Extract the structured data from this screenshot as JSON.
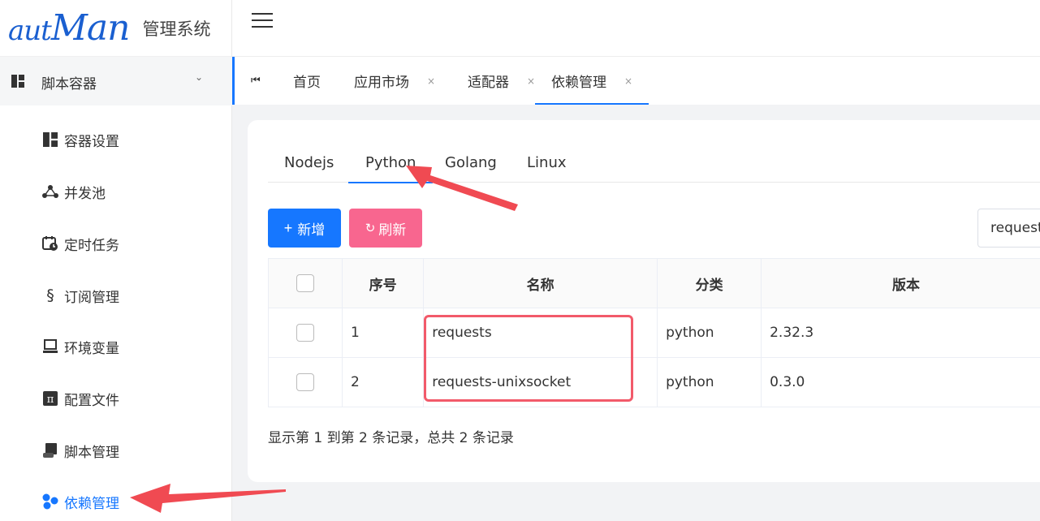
{
  "app": {
    "logo_text_small": "aut",
    "logo_text_big": "Man",
    "system_name": "管理系统"
  },
  "sidebar": {
    "group": {
      "label": "脚本容器",
      "icon": "dashboard-icon"
    },
    "items": [
      {
        "label": "容器设置",
        "icon": "layout-icon"
      },
      {
        "label": "并发池",
        "icon": "network-icon"
      },
      {
        "label": "定时任务",
        "icon": "calendar-clock-icon"
      },
      {
        "label": "订阅管理",
        "icon": "section-icon"
      },
      {
        "label": "环境变量",
        "icon": "monitor-icon"
      },
      {
        "label": "配置文件",
        "icon": "pi-icon"
      },
      {
        "label": "脚本管理",
        "icon": "scroll-icon"
      },
      {
        "label": "依赖管理",
        "icon": "cubes-icon"
      }
    ]
  },
  "tabs": [
    {
      "label": "首页"
    },
    {
      "label": "应用市场",
      "close": "×"
    },
    {
      "label": "适配器",
      "close": "×"
    },
    {
      "label": "依赖管理",
      "close": "×"
    }
  ],
  "subtabs": [
    "Nodejs",
    "Python",
    "Golang",
    "Linux"
  ],
  "toolbar": {
    "add_label": "新增",
    "refresh_label": "刷新",
    "search_value": "requests"
  },
  "table": {
    "headers": [
      "序号",
      "名称",
      "分类",
      "版本"
    ],
    "rows": [
      {
        "idx": "1",
        "name": "requests",
        "category": "python",
        "version": "2.32.3"
      },
      {
        "idx": "2",
        "name": "requests-unixsocket",
        "category": "python",
        "version": "0.3.0"
      }
    ]
  },
  "footer": "显示第 1 到第 2 条记录，总共 2 条记录",
  "colors": {
    "primary": "#1677ff",
    "refresh": "#f8668f",
    "annotation": "#f25a6a"
  }
}
